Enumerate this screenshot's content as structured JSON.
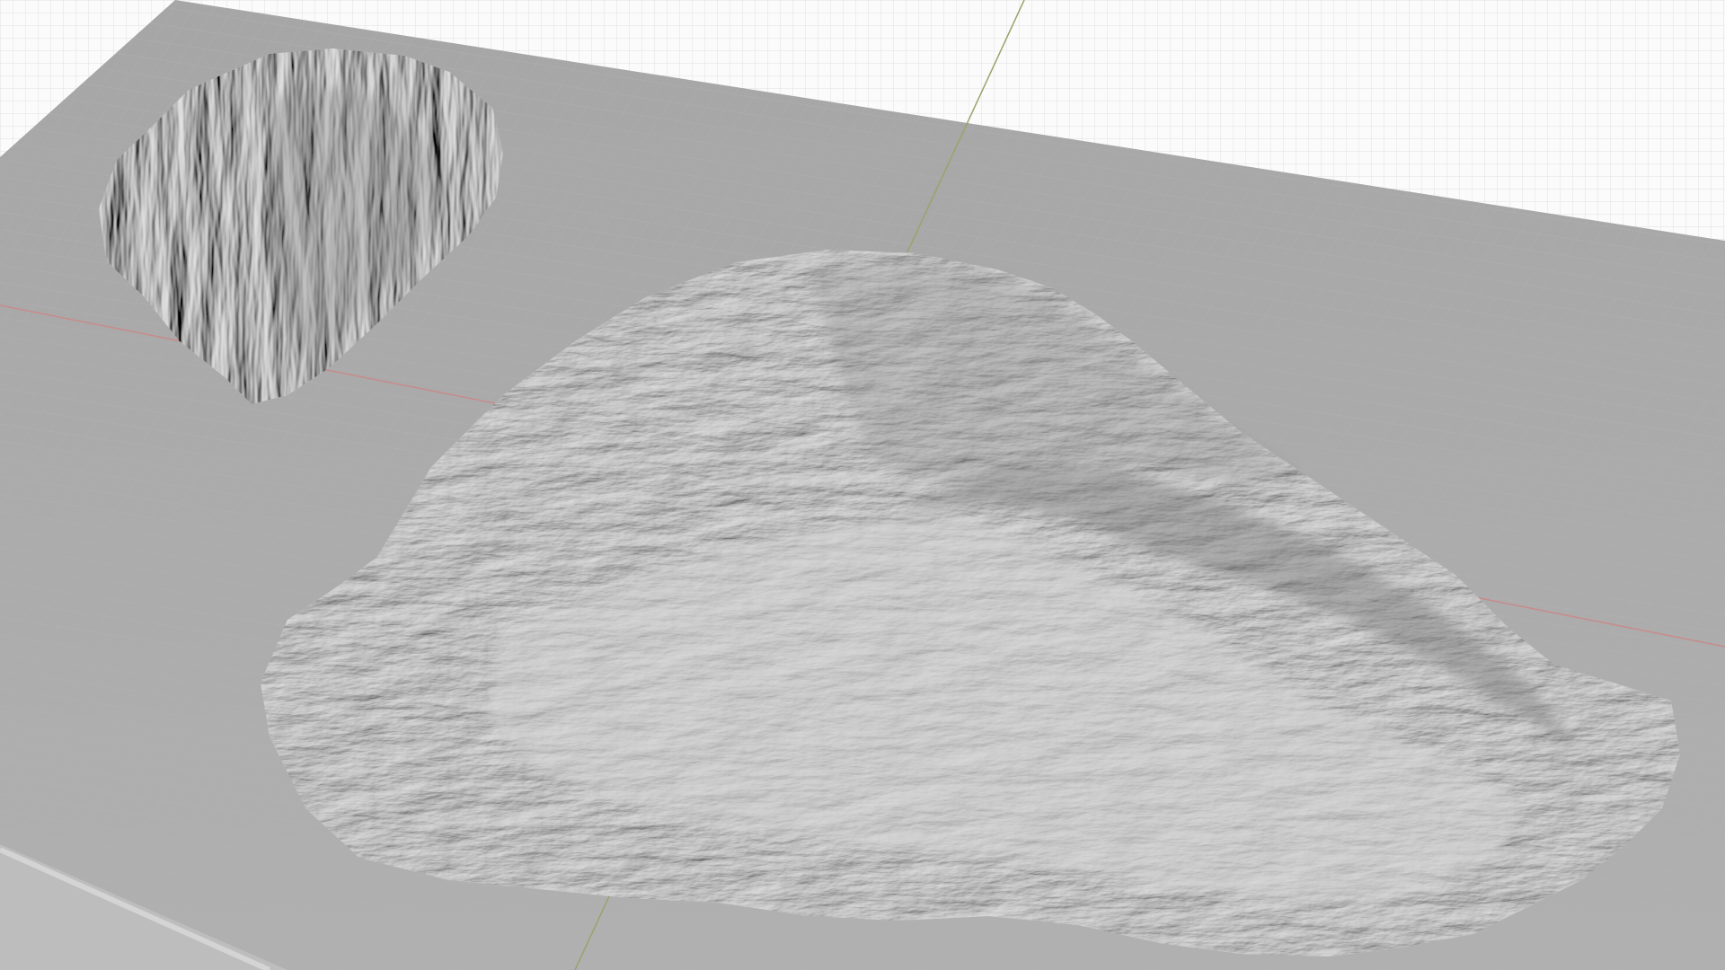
{
  "viewport": {
    "kind": "3d-viewport",
    "background_color": "#fbfbfb",
    "grid_color": "#d9d9d9",
    "plane_color": "#a9a9a9",
    "plane_edge_color": "#c2c2c2",
    "terrain_color": "#c4c4c4",
    "terrain_shadow_color": "#8d8d8d",
    "x_axis_color": "#c98a8a",
    "y_axis_color": "#9aa36a"
  },
  "scene": {
    "object": "terrain-relief-mesh",
    "islands": [
      "small-island",
      "large-island"
    ]
  }
}
